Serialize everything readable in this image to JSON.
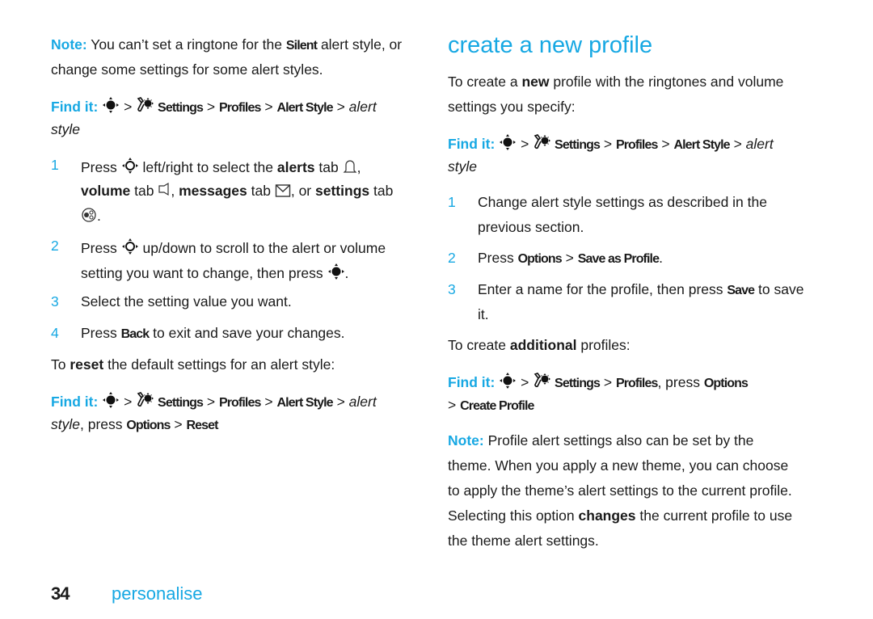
{
  "page": {
    "number": "34",
    "section": "personalise",
    "accent_color": "#17a8e3"
  },
  "left": {
    "note": {
      "label": "Note:",
      "line1_pre": "You can’t set a ringtone for the",
      "line1_kw": "Silent",
      "line1_post": "alert style, or",
      "line2": "change some settings for some alert styles."
    },
    "findit1": {
      "label": "Find it:",
      "sep": ">",
      "settings": "Settings",
      "profiles": "Profiles",
      "alert_style": "Alert Style",
      "alert": "alert",
      "style": "style"
    },
    "steps": [
      {
        "num": "1",
        "l1_pre": "Press",
        "l1_mid": "left/right to select the",
        "l1_kw": "alerts",
        "l1_post": "tab",
        "l2_kw1": "volume",
        "l2_t1": "tab",
        "l2_kw2": "messages",
        "l2_t2": "tab",
        "l2_or": ", or",
        "l2_kw3": "settings",
        "l2_t3": "tab"
      },
      {
        "num": "2",
        "l1_pre": "Press",
        "l1_post": "up/down to scroll to the alert or volume",
        "l2": "setting you want to change, then press"
      },
      {
        "num": "3",
        "text": "Select the setting value you want."
      },
      {
        "num": "4",
        "pre": "Press",
        "kw": "Back",
        "post": "to exit and save your changes."
      }
    ],
    "reset_intro": {
      "pre": "To",
      "kw": "reset",
      "post": "the default settings for an alert style:"
    },
    "findit2": {
      "label": "Find it:",
      "settings": "Settings",
      "profiles": "Profiles",
      "alert_style": "Alert Style",
      "alert": "alert",
      "style": "style",
      "press": ", press",
      "options": "Options",
      "reset": "Reset"
    }
  },
  "right": {
    "heading": "create a new profile",
    "intro": {
      "pre": "To create a",
      "kw": "new",
      "post": "profile with the ringtones and volume",
      "line2": "settings you specify:"
    },
    "findit1": {
      "label": "Find it:",
      "settings": "Settings",
      "profiles": "Profiles",
      "alert_style": "Alert Style",
      "alert": "alert",
      "style": "style"
    },
    "steps": [
      {
        "num": "1",
        "l1": "Change alert style settings as described in the",
        "l2": "previous section."
      },
      {
        "num": "2",
        "pre": "Press",
        "options": "Options",
        "save_as": "Save as Profile",
        "end": "."
      },
      {
        "num": "3",
        "pre": "Enter a name for the profile, then press",
        "kw": "Save",
        "post": "to save",
        "l2": "it."
      }
    ],
    "additional": {
      "pre": "To create",
      "kw": "additional",
      "post": "profiles:"
    },
    "findit2": {
      "label": "Find it:",
      "settings": "Settings",
      "profiles": "Profiles",
      "press": ", press",
      "options": "Options",
      "create": "Create Profile"
    },
    "note": {
      "label": "Note:",
      "l1": "Profile alert settings also can be set by the",
      "l2": "theme. When you apply a new theme, you can choose",
      "l3": "to apply the theme’s alert settings to the current profile.",
      "l4_pre": "Selecting this option",
      "l4_kw": "changes",
      "l4_post": "the current profile to use",
      "l5": "the theme alert settings."
    }
  }
}
